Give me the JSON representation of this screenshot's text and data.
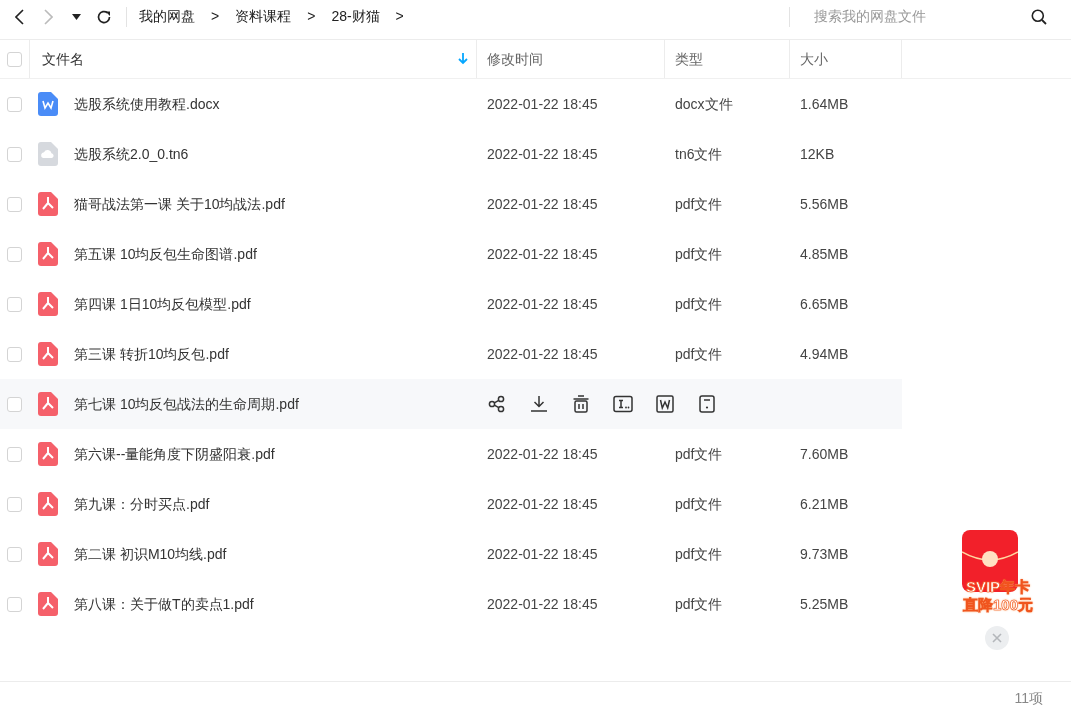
{
  "toolbar": {
    "back_enabled": true,
    "forward_enabled": false,
    "select_all_checked": false,
    "breadcrumbs": [
      {
        "label": "我的网盘",
        "separator": ">"
      },
      {
        "label": "资料课程",
        "separator": ">"
      },
      {
        "label": "28-财猫",
        "separator": ">"
      }
    ],
    "search": {
      "placeholder": "搜索我的网盘文件"
    }
  },
  "columns": [
    {
      "label": "文件名",
      "sorted": true
    },
    {
      "label": "修改时间",
      "sorted": false
    },
    {
      "label": "类型",
      "sorted": false
    },
    {
      "label": "大小",
      "sorted": false
    }
  ],
  "rows": [
    {
      "kind": "docx",
      "name": "选股系统使用教程.docx",
      "modified": "2022-01-22 18:45",
      "type": "docx文件",
      "size": "1.64MB",
      "checked": false,
      "hovered": false
    },
    {
      "kind": "other",
      "name": "选股系统2.0_0.tn6",
      "modified": "2022-01-22 18:45",
      "type": "tn6文件",
      "size": "12KB",
      "checked": false,
      "hovered": false
    },
    {
      "kind": "pdf",
      "name": "猫哥战法第一课 关于10均战法.pdf",
      "modified": "2022-01-22 18:45",
      "type": "pdf文件",
      "size": "5.56MB",
      "checked": false,
      "hovered": false
    },
    {
      "kind": "pdf",
      "name": "第五课 10均反包生命图谱.pdf",
      "modified": "2022-01-22 18:45",
      "type": "pdf文件",
      "size": "4.85MB",
      "checked": false,
      "hovered": false
    },
    {
      "kind": "pdf",
      "name": "第四课 1日10均反包模型.pdf",
      "modified": "2022-01-22 18:45",
      "type": "pdf文件",
      "size": "6.65MB",
      "checked": false,
      "hovered": false
    },
    {
      "kind": "pdf",
      "name": "第三课 转折10均反包.pdf",
      "modified": "2022-01-22 18:45",
      "type": "pdf文件",
      "size": "4.94MB",
      "checked": false,
      "hovered": false
    },
    {
      "kind": "pdf",
      "name": "第七课 10均反包战法的生命周期.pdf",
      "checked": false,
      "hovered": true
    },
    {
      "kind": "pdf",
      "name": "第六课--量能角度下阴盛阳衰.pdf",
      "modified": "2022-01-22 18:45",
      "type": "pdf文件",
      "size": "7.60MB",
      "checked": false,
      "hovered": false
    },
    {
      "kind": "pdf",
      "name": "第九课：分时买点.pdf",
      "modified": "2022-01-22 18:45",
      "type": "pdf文件",
      "size": "6.21MB",
      "checked": false,
      "hovered": false
    },
    {
      "kind": "pdf",
      "name": "第二课 初识M10均线.pdf",
      "modified": "2022-01-22 18:45",
      "type": "pdf文件",
      "size": "9.73MB",
      "checked": false,
      "hovered": false
    },
    {
      "kind": "pdf",
      "name": "第八课：关于做T的卖点1.pdf",
      "modified": "2022-01-22 18:45",
      "type": "pdf文件",
      "size": "5.25MB",
      "checked": false,
      "hovered": false
    }
  ],
  "promo": {
    "line_1": "SVIP年卡",
    "line_2": "直降100元"
  },
  "status_bar": {
    "count": "11项"
  }
}
